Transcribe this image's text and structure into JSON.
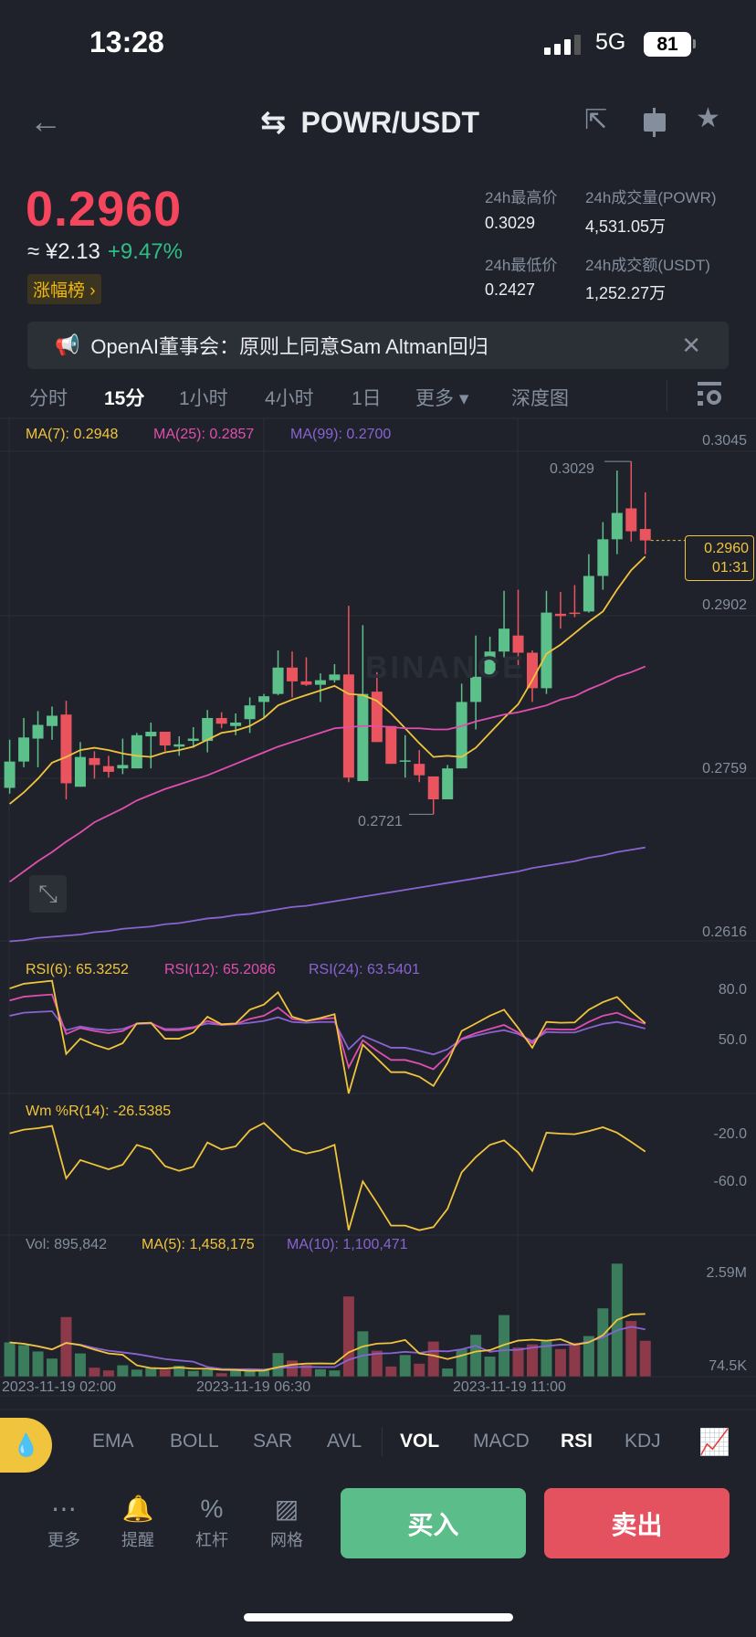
{
  "status": {
    "time": "13:28",
    "network": "5G",
    "battery": "81"
  },
  "header": {
    "pair": "POWR/USDT"
  },
  "ticker": {
    "price": "0.2960",
    "cny": "≈ ¥2.13",
    "change": "+9.47%",
    "rank_badge": "涨幅榜 ›",
    "high_label": "24h最高价",
    "high": "0.3029",
    "vol_label": "24h成交量(POWR)",
    "vol": "4,531.05万",
    "low_label": "24h最低价",
    "low": "0.2427",
    "amt_label": "24h成交额(USDT)",
    "amt": "1,252.27万"
  },
  "announcement": {
    "text": "OpenAI董事会：原则上同意Sam Altman回归"
  },
  "timeframes": [
    "分时",
    "15分",
    "1小时",
    "4小时",
    "1日",
    "更多 ▾",
    "深度图"
  ],
  "colors": {
    "up": "#5cc08b",
    "down": "#e9545f",
    "ma7": "#f0c43c",
    "ma25": "#e04fb0",
    "ma99": "#8a63d2"
  },
  "indicators_legend": {
    "ma7": "MA(7): 0.2948",
    "ma25": "MA(25): 0.2857",
    "ma99": "MA(99): 0.2700",
    "rsi6": "RSI(6): 65.3252",
    "rsi12": "RSI(12): 65.2086",
    "rsi24": "RSI(24): 63.5401",
    "wr": "Wm %R(14): -26.5385",
    "vol": "Vol: 895,842",
    "vol_ma5": "MA(5): 1,458,175",
    "vol_ma10": "MA(10): 1,100,471"
  },
  "axes": {
    "price": [
      "0.3045",
      "0.2902",
      "0.2759",
      "0.2616"
    ],
    "rsi": [
      "80.0",
      "50.0"
    ],
    "wr": [
      "-20.0",
      "-60.0"
    ],
    "vol": [
      "2.59M",
      "74.5K"
    ],
    "time": [
      "2023-11-19 02:00",
      "2023-11-19 06:30",
      "2023-11-19 11:00"
    ]
  },
  "chart_data": {
    "type": "candlestick",
    "interval": "15m",
    "price_range": [
      0.2616,
      0.3045
    ],
    "high_marker": "0.3029",
    "low_marker": "0.2721",
    "last_price": "0.2960",
    "countdown": "01:31",
    "watermark": "BINANCE",
    "candles_ohlc": [
      [
        0.2744,
        0.2786,
        0.2739,
        0.2767
      ],
      [
        0.2767,
        0.2805,
        0.2762,
        0.2788
      ],
      [
        0.2787,
        0.2811,
        0.2762,
        0.2799
      ],
      [
        0.2798,
        0.2815,
        0.2786,
        0.2807
      ],
      [
        0.2808,
        0.282,
        0.2734,
        0.2748
      ],
      [
        0.2745,
        0.2784,
        0.2745,
        0.2771
      ],
      [
        0.277,
        0.2776,
        0.2752,
        0.2764
      ],
      [
        0.2763,
        0.2772,
        0.2753,
        0.2758
      ],
      [
        0.2761,
        0.2787,
        0.2756,
        0.2764
      ],
      [
        0.2761,
        0.2792,
        0.2761,
        0.279
      ],
      [
        0.2789,
        0.2801,
        0.2761,
        0.2793
      ],
      [
        0.2793,
        0.2793,
        0.2776,
        0.2781
      ],
      [
        0.278,
        0.2789,
        0.2772,
        0.2782
      ],
      [
        0.2785,
        0.2797,
        0.2779,
        0.2787
      ],
      [
        0.2785,
        0.2812,
        0.2775,
        0.2805
      ],
      [
        0.2805,
        0.281,
        0.2796,
        0.28
      ],
      [
        0.2798,
        0.2809,
        0.279,
        0.2801
      ],
      [
        0.2804,
        0.2823,
        0.2792,
        0.2816
      ],
      [
        0.2819,
        0.2826,
        0.2805,
        0.2824
      ],
      [
        0.2826,
        0.2864,
        0.2825,
        0.2849
      ],
      [
        0.2849,
        0.2863,
        0.2823,
        0.2837
      ],
      [
        0.2837,
        0.2858,
        0.2833,
        0.2834
      ],
      [
        0.2834,
        0.2844,
        0.2819,
        0.2838
      ],
      [
        0.2838,
        0.2852,
        0.2836,
        0.2843
      ],
      [
        0.2843,
        0.2903,
        0.2749,
        0.2753
      ],
      [
        0.275,
        0.2886,
        0.275,
        0.2826
      ],
      [
        0.2828,
        0.2845,
        0.2784,
        0.2784
      ],
      [
        0.2798,
        0.2798,
        0.2765,
        0.2765
      ],
      [
        0.2767,
        0.279,
        0.2753,
        0.2768
      ],
      [
        0.2765,
        0.2777,
        0.2749,
        0.2755
      ],
      [
        0.2754,
        0.2754,
        0.2721,
        0.2734
      ],
      [
        0.2734,
        0.2764,
        0.2734,
        0.2761
      ],
      [
        0.2761,
        0.2835,
        0.2761,
        0.2819
      ],
      [
        0.2819,
        0.2877,
        0.2795,
        0.2841
      ],
      [
        0.2842,
        0.2876,
        0.2842,
        0.2863
      ],
      [
        0.2863,
        0.2916,
        0.2858,
        0.2883
      ],
      [
        0.2877,
        0.2917,
        0.2851,
        0.2862
      ],
      [
        0.2862,
        0.2864,
        0.2819,
        0.2831
      ],
      [
        0.2831,
        0.2916,
        0.2826,
        0.2897
      ],
      [
        0.2896,
        0.2915,
        0.2883,
        0.2894
      ],
      [
        0.2897,
        0.2921,
        0.2893,
        0.2896
      ],
      [
        0.2898,
        0.2948,
        0.2897,
        0.2929
      ],
      [
        0.2929,
        0.2976,
        0.2917,
        0.2961
      ],
      [
        0.2961,
        0.3021,
        0.2948,
        0.2984
      ],
      [
        0.2988,
        0.3029,
        0.2959,
        0.2968
      ],
      [
        0.297,
        0.3002,
        0.2948,
        0.296
      ]
    ],
    "ma7": [
      0.273,
      0.274,
      0.2752,
      0.2766,
      0.2771,
      0.2777,
      0.2779,
      0.2777,
      0.2774,
      0.2772,
      0.2771,
      0.2775,
      0.2777,
      0.278,
      0.2786,
      0.2792,
      0.2794,
      0.2798,
      0.2805,
      0.2816,
      0.2821,
      0.2825,
      0.2829,
      0.2833,
      0.2826,
      0.2825,
      0.282,
      0.2809,
      0.2796,
      0.2783,
      0.2771,
      0.2772,
      0.2771,
      0.2779,
      0.2792,
      0.2805,
      0.2817,
      0.2838,
      0.2861,
      0.2869,
      0.2879,
      0.2889,
      0.2898,
      0.2917,
      0.2934,
      0.2946
    ],
    "ma25": [
      0.2662,
      0.2671,
      0.268,
      0.2688,
      0.2697,
      0.2705,
      0.2714,
      0.272,
      0.2726,
      0.2733,
      0.2738,
      0.2743,
      0.2747,
      0.2751,
      0.2755,
      0.276,
      0.2765,
      0.277,
      0.2775,
      0.278,
      0.2784,
      0.2788,
      0.2792,
      0.2796,
      0.2797,
      0.2798,
      0.2798,
      0.2797,
      0.2796,
      0.2796,
      0.2795,
      0.2795,
      0.2798,
      0.2802,
      0.2805,
      0.2808,
      0.281,
      0.2813,
      0.2816,
      0.2821,
      0.2824,
      0.283,
      0.2835,
      0.2841,
      0.2845,
      0.285
    ],
    "ma99": [
      0.261,
      0.2611,
      0.2613,
      0.2614,
      0.2615,
      0.2616,
      0.2618,
      0.2619,
      0.2621,
      0.2622,
      0.2623,
      0.2625,
      0.2626,
      0.2628,
      0.263,
      0.2631,
      0.2633,
      0.2634,
      0.2636,
      0.2638,
      0.264,
      0.2641,
      0.2643,
      0.2645,
      0.2647,
      0.2649,
      0.2651,
      0.2653,
      0.2655,
      0.2657,
      0.2659,
      0.2661,
      0.2663,
      0.2665,
      0.2667,
      0.2669,
      0.2671,
      0.2674,
      0.2676,
      0.2678,
      0.268,
      0.2683,
      0.2685,
      0.2688,
      0.269,
      0.2692
    ],
    "rsi6": [
      82.7,
      85.5,
      86.4,
      87.3,
      43.6,
      52.7,
      49.1,
      46.4,
      50.0,
      61.8,
      62.2,
      52.7,
      52.7,
      56.4,
      65.8,
      61.3,
      61.8,
      70.0,
      73.1,
      80.4,
      65.8,
      63.3,
      65.1,
      67.3,
      20.0,
      49.1,
      40.9,
      32.7,
      32.7,
      30.0,
      24.5,
      38.2,
      57.3,
      61.8,
      66.4,
      70.0,
      59.1,
      47.3,
      62.7,
      62.2,
      62.4,
      70.0,
      74.5,
      77.6,
      69.1,
      62.0
    ],
    "rsi12": [
      75.5,
      77.8,
      78.5,
      79.1,
      55.5,
      59.1,
      57.3,
      56.0,
      57.3,
      61.8,
      62.2,
      57.8,
      57.8,
      59.1,
      63.3,
      60.9,
      61.5,
      64.5,
      66.4,
      71.3,
      64.5,
      63.3,
      64.5,
      65.1,
      35.5,
      51.8,
      45.5,
      40.0,
      40.0,
      37.8,
      34.5,
      42.7,
      52.7,
      56.0,
      58.5,
      60.9,
      56.4,
      50.0,
      58.5,
      58.2,
      58.2,
      62.7,
      66.4,
      68.2,
      64.5,
      61.5
    ],
    "rsi24": [
      66.4,
      68.2,
      68.7,
      69.1,
      57.8,
      60.0,
      58.5,
      57.8,
      58.5,
      61.5,
      61.8,
      58.5,
      58.5,
      59.6,
      61.8,
      60.9,
      61.3,
      62.2,
      63.3,
      65.5,
      62.7,
      62.2,
      62.7,
      62.7,
      46.4,
      54.5,
      50.9,
      47.3,
      47.3,
      45.5,
      43.3,
      46.4,
      52.4,
      54.5,
      56.4,
      57.8,
      55.5,
      51.3,
      56.7,
      56.4,
      56.4,
      59.1,
      61.5,
      62.7,
      60.9,
      58.7
    ],
    "wr14": [
      -17.9,
      -14.8,
      -13.6,
      -11.7,
      -56.1,
      -40.6,
      -44.5,
      -48.4,
      -44.5,
      -27.7,
      -31.6,
      -45.8,
      -49.7,
      -46.3,
      -25.7,
      -31.6,
      -29.0,
      -15.4,
      -9.2,
      -20.5,
      -31.6,
      -35.0,
      -32.4,
      -27.7,
      -100,
      -58.7,
      -76.8,
      -96.1,
      -96.1,
      -100,
      -97.4,
      -81.9,
      -51.0,
      -38.1,
      -27.7,
      -23.9,
      -34.2,
      -49.7,
      -17.4,
      -18.2,
      -18.7,
      -16.1,
      -12.8,
      -17.4,
      -25.2,
      -33.4
    ],
    "volume_millions": [
      0.86,
      0.79,
      0.63,
      0.45,
      1.5,
      0.58,
      0.22,
      0.15,
      0.28,
      0.17,
      0.23,
      0.17,
      0.27,
      0.14,
      0.17,
      0.08,
      0.15,
      0.17,
      0.17,
      0.59,
      0.4,
      0.29,
      0.18,
      0.15,
      2.02,
      1.14,
      0.65,
      0.25,
      0.54,
      0.32,
      0.88,
      0.2,
      0.69,
      1.05,
      0.5,
      1.55,
      0.73,
      0.81,
      0.92,
      0.69,
      0.85,
      1.02,
      1.72,
      2.85,
      1.4,
      0.9
    ]
  },
  "indicator_tabs": [
    "EMA",
    "BOLL",
    "SAR",
    "AVL",
    "VOL",
    "MACD",
    "RSI",
    "KDJ"
  ],
  "actions": [
    "更多",
    "提醒",
    "杠杆",
    "网格"
  ],
  "buy_label": "买入",
  "sell_label": "卖出"
}
